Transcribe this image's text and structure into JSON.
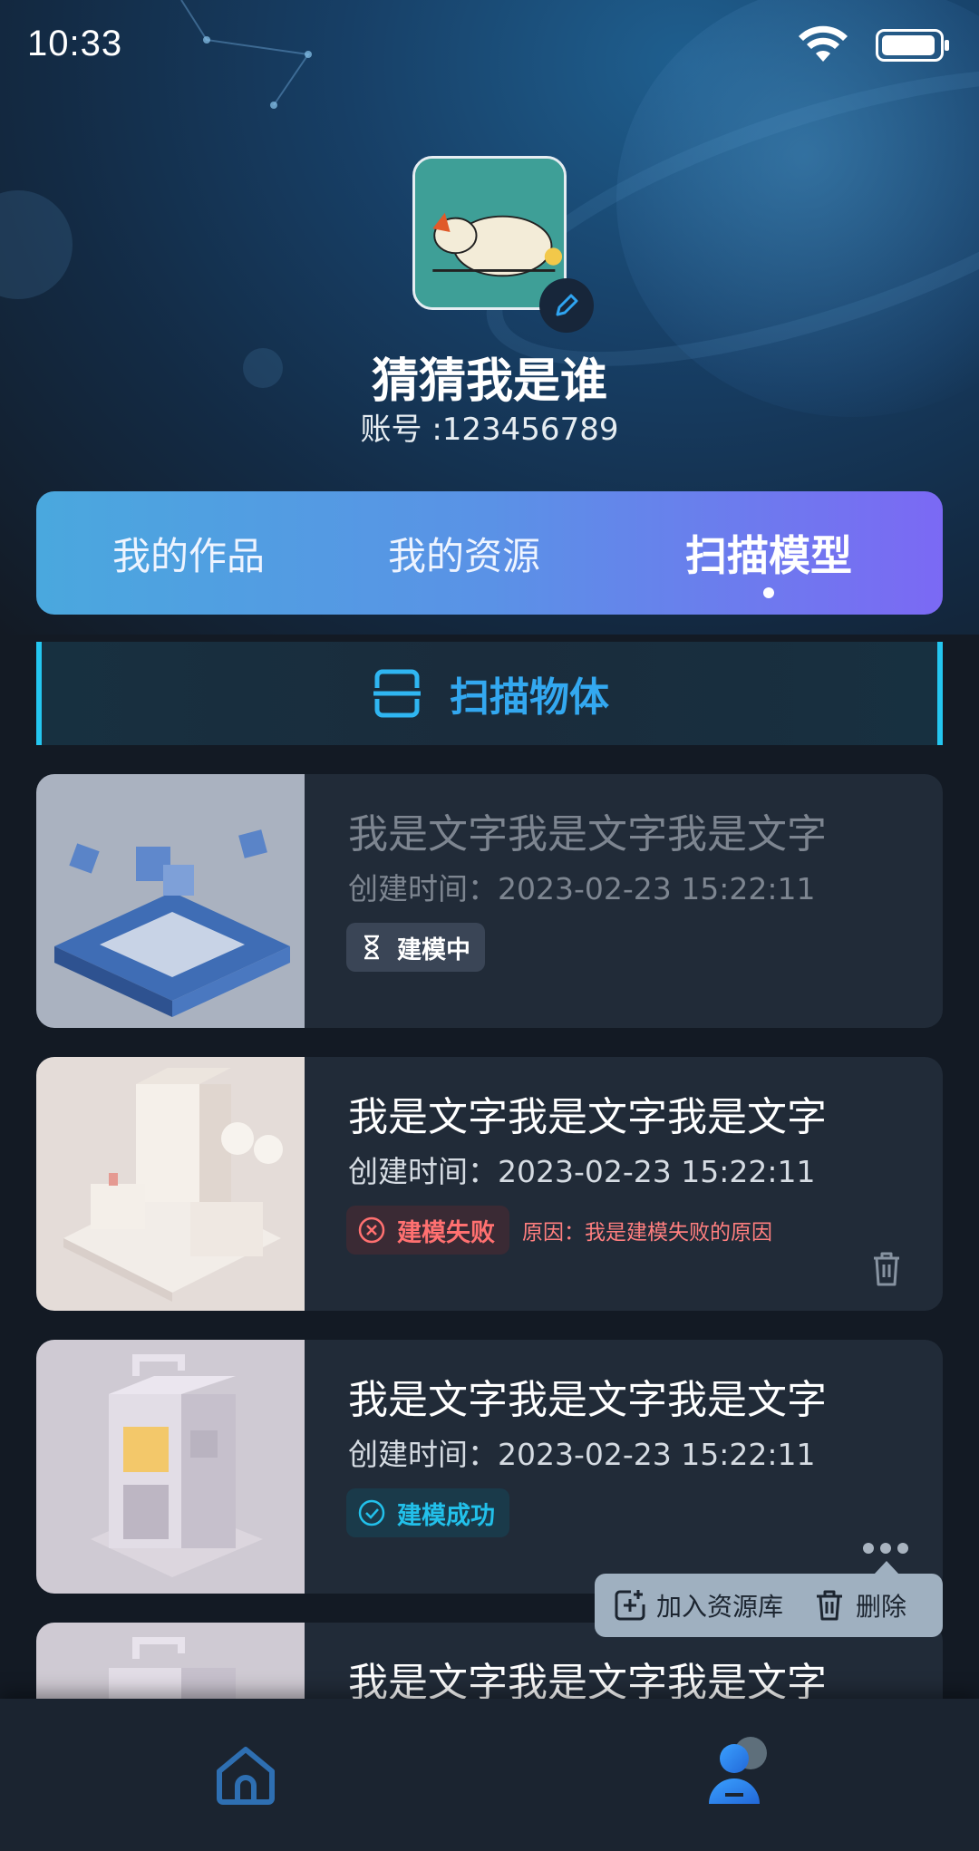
{
  "status_bar": {
    "time": "10:33",
    "wifi_icon": "wifi-icon",
    "battery_icon": "battery-icon"
  },
  "profile": {
    "nickname": "猜猜我是谁",
    "account": "账号 :123456789",
    "edit_icon": "pencil-icon"
  },
  "tabs": [
    {
      "label": "我的作品",
      "active": false
    },
    {
      "label": "我的资源",
      "active": false
    },
    {
      "label": "扫描模型",
      "active": true
    }
  ],
  "scan_button": {
    "label": "扫描物体",
    "icon": "scan-icon"
  },
  "models": [
    {
      "title": "我是文字我是文字我是文字",
      "created": "创建时间：2023-02-23 15:22:11",
      "status": "building",
      "status_label": "建模中"
    },
    {
      "title": "我是文字我是文字我是文字",
      "created": "创建时间：2023-02-23 15:22:11",
      "status": "failed",
      "status_label": "建模失败",
      "reason": "原因：我是建模失败的原因"
    },
    {
      "title": "我是文字我是文字我是文字",
      "created": "创建时间：2023-02-23 15:22:11",
      "status": "success",
      "status_label": "建模成功"
    },
    {
      "title": "我是文字我是文字我是文字"
    }
  ],
  "popup_menu": {
    "add_label": "加入资源库",
    "delete_label": "删除"
  },
  "bottom_nav": [
    {
      "icon": "home-icon"
    },
    {
      "icon": "profile-icon",
      "active": true
    }
  ],
  "colors": {
    "accent": "#24c6f0",
    "tab_start": "#4aa8de",
    "tab_end": "#7b69f4",
    "fail": "#ff7070",
    "success": "#22c0ea"
  }
}
